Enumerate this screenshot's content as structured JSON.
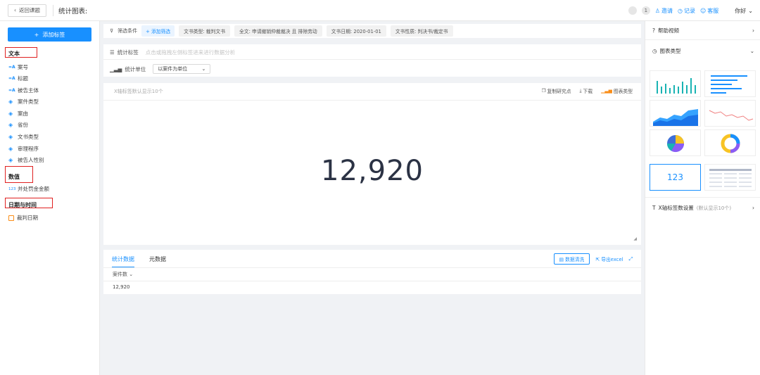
{
  "header": {
    "back_label": "返回课题",
    "page_title": "统计图表:",
    "badge_count": "1",
    "invite_label": "邀请",
    "records_label": "记录",
    "support_label": "客服",
    "user_name": "你好"
  },
  "sidebar": {
    "add_tag_label": "添加标签",
    "groups": {
      "text": "文本",
      "number": "数值",
      "datetime": "日期与时间"
    },
    "text_items": [
      "案号",
      "标题",
      "被告主体",
      "案件类型",
      "案由",
      "省份",
      "文书类型",
      "审理程序",
      "被告人性别"
    ],
    "number_items": [
      "并处罚金金额"
    ],
    "datetime_items": [
      "裁判日期"
    ]
  },
  "filters": {
    "label": "筛选条件",
    "add_label": "+ 添加筛选",
    "chips": [
      "文书类型: 裁判文书",
      "全文: 申请撤销仲裁裁决 且 排除劳动",
      "文书日期: 2020-01-01",
      "文书性质: 判决书/裁定书"
    ]
  },
  "stats": {
    "tag_label": "统计标签",
    "tag_placeholder": "点击或拖拽左侧标签进来进行数据分析",
    "unit_label": "统计单位",
    "unit_value": "以案件为单位"
  },
  "chart": {
    "hint": "X轴标签默认显示10个",
    "tool_copy": "复制研究点",
    "tool_download": "下载",
    "tool_type": "图表类型",
    "big_number": "12,920"
  },
  "chart_data": {
    "type": "table",
    "title": "",
    "values": [
      12920
    ]
  },
  "data_panel": {
    "tab_stats": "统计数据",
    "tab_meta": "元数据",
    "clean_label": "数据清洗",
    "export_label": "导出excel",
    "column_header": "案件数",
    "cell_value": "12,920"
  },
  "right_panel": {
    "help_video": "帮助视频",
    "chart_type": "图表类型",
    "number_tile": "123",
    "x_axis_setting": "X轴标签数设置",
    "x_axis_hint": "(默认显示10个)"
  },
  "colors": {
    "accent": "#1890ff",
    "annotation_red": "#e02020",
    "number_text": "#2b3244"
  }
}
